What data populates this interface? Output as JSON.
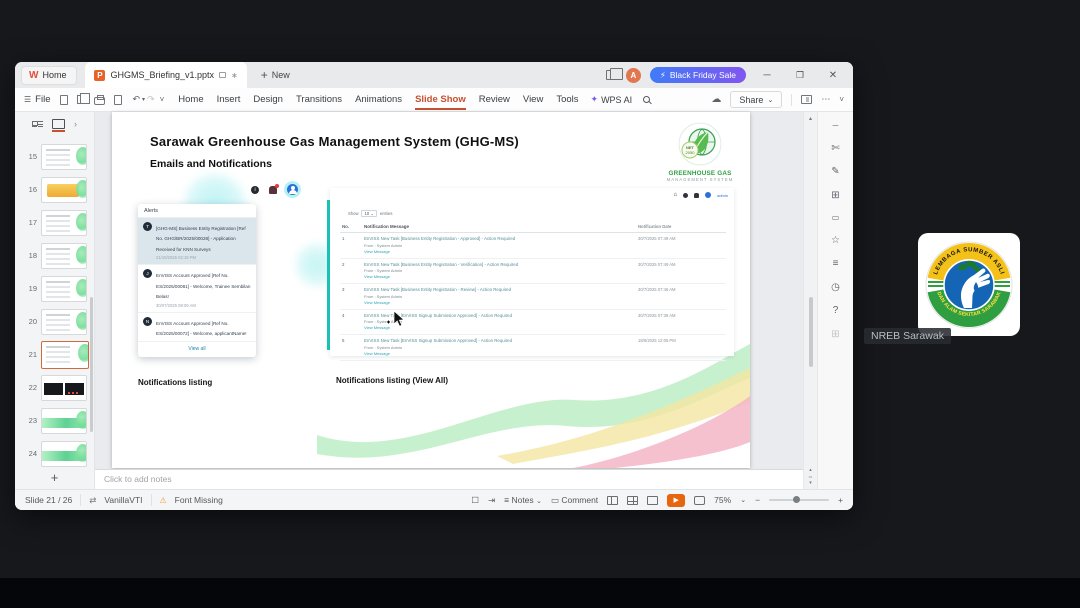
{
  "meeting": {
    "participant_name": "NREB Sarawak",
    "logo_top_text": "LEMBAGA SUMBER ASLI",
    "logo_bottom_text": "DAN ALAM SEKITAR SARAWAK"
  },
  "window": {
    "home_tab": "Home",
    "doc_tab": "GHGMS_Briefing_v1.pptx",
    "new_label": "New",
    "promo_label": "Black Friday Sale",
    "file_label": "File",
    "menus": [
      "Home",
      "Insert",
      "Design",
      "Transitions",
      "Animations",
      "Slide Show",
      "Review",
      "View",
      "Tools"
    ],
    "active_menu": "Slide Show",
    "wps_ai_label": "WPS AI",
    "share_label": "Share",
    "avatar_initial": "A",
    "colors": {
      "accent": "#c7502f",
      "promo_from": "#3f7bf7",
      "promo_to": "#8156f0",
      "play": "#e8650f"
    }
  },
  "slide_panel": {
    "selected": 21,
    "slides": [
      {
        "num": 15,
        "type": "list"
      },
      {
        "num": 16,
        "type": "yellow"
      },
      {
        "num": 17,
        "type": "list"
      },
      {
        "num": 18,
        "type": "list"
      },
      {
        "num": 19,
        "type": "list"
      },
      {
        "num": 20,
        "type": "list"
      },
      {
        "num": 21,
        "type": "list"
      },
      {
        "num": 22,
        "type": "dark"
      },
      {
        "num": 23,
        "type": "green"
      },
      {
        "num": 24,
        "type": "green"
      }
    ]
  },
  "slide": {
    "title": "Sarawak Greenhouse Gas Management System (GHG-MS)",
    "subtitle": "Emails and Notifications",
    "logo_line1": "GREENHOUSE GAS",
    "logo_line2": "MANAGEMENT SYSTEM",
    "logo_badge": "NET",
    "logo_badge2": "2050",
    "caption_left": "Notifications listing",
    "caption_right": "Notifications listing (View All)",
    "alerts": {
      "header": "Alerts",
      "view_all": "View all",
      "items": [
        {
          "initial": "T",
          "text": "[GHG-MS] Business Entity Registration [Ref No. GHG/BR/2025/00028] - Application Received for KNN Surveys",
          "date": "21/10/2025 02:19 PM",
          "highlight": true
        },
        {
          "initial": "J",
          "text": "EnVISS Account Approved [Ref No. ES/2025/00081] - Welcome, Trainee Sembilan Belas!",
          "date": "30/07/2025 08:09 AM",
          "highlight": false
        },
        {
          "initial": "N",
          "text": "EnVISS Account Approved [Ref No. ES/2025/00072] - Welcome, applicantName!",
          "date": "",
          "highlight": false
        }
      ]
    },
    "table": {
      "user": "admin",
      "show_label": "Show",
      "show_value": "10",
      "entries_label": "entries",
      "headers": [
        "No.",
        "Notification Message",
        "Notification Date"
      ],
      "rows": [
        {
          "no": "1",
          "msg": "EnVISS New Task [Business Entity Registration - Approved] - Action Required",
          "from": "From : System Admin",
          "link": "View Message",
          "date": "30/7/2025 07:49 AM"
        },
        {
          "no": "2",
          "msg": "EnVISS New Task [Business Entity Registration - Verification] - Action Required",
          "from": "From : System Admin",
          "link": "View Message",
          "date": "30/7/2025 07:49 AM"
        },
        {
          "no": "3",
          "msg": "EnVISS New Task [Business Entity Registration - Review] - Action Required",
          "from": "From : System Admin",
          "link": "View Message",
          "date": "30/7/2025 07:46 AM"
        },
        {
          "no": "4",
          "msg": "EnVISS New Task [EnVISS Signup Submission Approved] - Action Required",
          "from": "From : System Admin",
          "link": "View Message",
          "date": "30/7/2025 07:39 AM"
        },
        {
          "no": "5",
          "msg": "EnVISS New Task [EnVISS Signup Submission Approved] - Action Required",
          "from": "From : System Admin",
          "link": "View Message",
          "date": "18/6/2025 12:06 PM"
        }
      ]
    }
  },
  "notes": {
    "placeholder": "Click to add notes"
  },
  "status_bar": {
    "slide_indicator": "Slide 21 / 26",
    "theme_name": "VanillaVTI",
    "font_missing": "Font Missing",
    "notes_label": "Notes",
    "comment_label": "Comment",
    "zoom_level": "75%"
  },
  "icons": {
    "hamburger": "☰",
    "undo": "↶",
    "redo": "↷",
    "chevron-down": "⌄",
    "collapse": "˅",
    "ellipsis": "⋯",
    "cloud": "☁",
    "close": "✕",
    "minimize": "─",
    "bolt": "⚡",
    "warning": "⚠",
    "play": "▶",
    "star": "☆",
    "scissors": "✄",
    "pencil": "✎",
    "clock": "◷",
    "help": "?",
    "grid": "⊞",
    "notes-lines": "≡",
    "box": "▭",
    "arrow-up": "▲",
    "tri-up": "▴",
    "tri-down": "▾",
    "home-glyph": "⌂",
    "caret-right": "›",
    "plus": "+",
    "minus": "−",
    "spark": "✦",
    "swap": "⇄",
    "tab-star": "∗",
    "arrow-into": "⇥",
    "page": "☐"
  }
}
